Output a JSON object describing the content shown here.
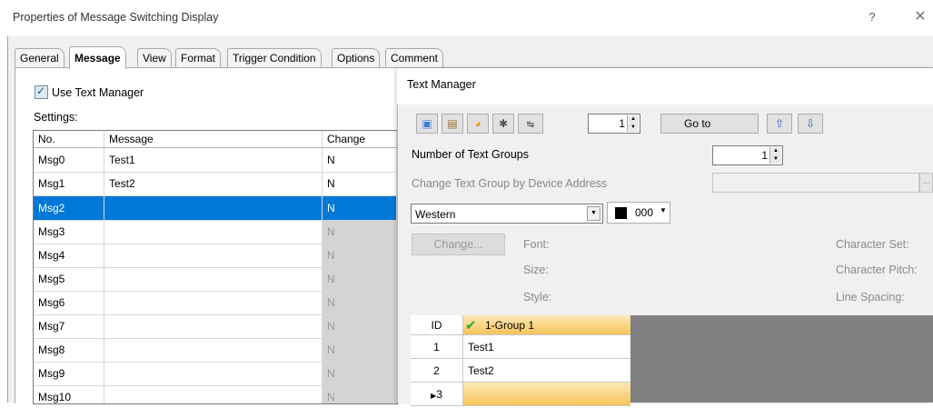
{
  "window": {
    "title": "Properties of Message Switching Display",
    "help_label": "?",
    "close_label": "✕"
  },
  "tabs": [
    {
      "label": "General"
    },
    {
      "label": "Message"
    },
    {
      "label": "View"
    },
    {
      "label": "Format"
    },
    {
      "label": "Trigger Condition"
    },
    {
      "label": "Options"
    },
    {
      "label": "Comment"
    }
  ],
  "use_text_manager": {
    "label": "Use Text Manager",
    "checked": true
  },
  "settings_label": "Settings:",
  "message_table": {
    "headers": [
      "No.",
      "Message",
      "Change"
    ],
    "rows": [
      {
        "no": "Msg0",
        "message": "Test1",
        "change": "N"
      },
      {
        "no": "Msg1",
        "message": "Test2",
        "change": "N"
      },
      {
        "no": "Msg2",
        "message": "",
        "change": "N"
      },
      {
        "no": "Msg3",
        "message": "",
        "change": "N"
      },
      {
        "no": "Msg4",
        "message": "",
        "change": "N"
      },
      {
        "no": "Msg5",
        "message": "",
        "change": "N"
      },
      {
        "no": "Msg6",
        "message": "",
        "change": "N"
      },
      {
        "no": "Msg7",
        "message": "",
        "change": "N"
      },
      {
        "no": "Msg8",
        "message": "",
        "change": "N"
      },
      {
        "no": "Msg9",
        "message": "",
        "change": "N"
      },
      {
        "no": "Msg10",
        "message": "",
        "change": "N"
      }
    ],
    "selected_row": "Msg2"
  },
  "text_manager": {
    "title": "Text Manager",
    "toolbar_icons": [
      "copy-icon",
      "paste-icon",
      "import-icon",
      "export-icon",
      "replace-icon"
    ],
    "goto_number": "1",
    "goto_label": "Go to",
    "nav_icons": [
      "move-up-icon",
      "move-down-icon"
    ],
    "number_of_text_groups_label": "Number of Text Groups",
    "number_of_text_groups_value": "1",
    "change_by_device_label": "Change Text Group by Device Address",
    "browse_label": "...",
    "language": "Western",
    "color_value": "000",
    "color_hex": "#000000",
    "change_button": "Change...",
    "labels": {
      "font": "Font:",
      "size": "Size:",
      "style": "Style:",
      "character_set": "Character Set:",
      "character_pitch": "Character Pitch:",
      "line_spacing": "Line Spacing:"
    },
    "grid": {
      "id_header": "ID",
      "group_header": "1-Group 1",
      "rows": [
        {
          "id": "1",
          "text": "Test1"
        },
        {
          "id": "2",
          "text": "Test2"
        },
        {
          "id": "3",
          "text": ""
        }
      ]
    }
  }
}
